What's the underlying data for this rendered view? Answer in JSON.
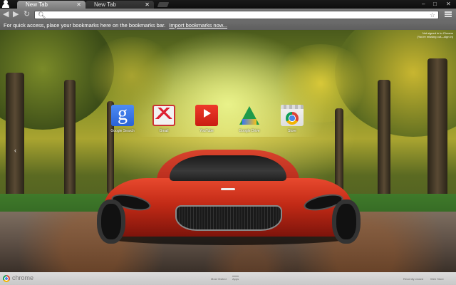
{
  "tabs": [
    {
      "label": "New Tab",
      "active": true
    },
    {
      "label": "New Tab",
      "active": false
    }
  ],
  "window_controls": {
    "minimize": "–",
    "maximize": "□",
    "close": "✕"
  },
  "toolbar": {
    "back_icon": "◀",
    "forward_icon": "▶",
    "reload_icon": "↻",
    "omnibox_value": "",
    "omnibox_placeholder": ""
  },
  "bookmarks_bar": {
    "message": "For quick access, place your bookmarks here on the bookmarks bar.",
    "import_link": "Import bookmarks now..."
  },
  "signin": {
    "line1": "Not signed in to Chrome",
    "line2": "(You're missing out—sign in)"
  },
  "apps": [
    {
      "label": "Google Search",
      "icon": "google-search-icon"
    },
    {
      "label": "Gmail",
      "icon": "gmail-icon"
    },
    {
      "label": "YouTube",
      "icon": "youtube-icon"
    },
    {
      "label": "Google Drive",
      "icon": "google-drive-icon"
    },
    {
      "label": "Store",
      "icon": "chrome-web-store-icon"
    }
  ],
  "footer": {
    "brand": "chrome",
    "panes": [
      "Most Visited",
      "Apps"
    ],
    "active_pane": "Apps",
    "recently_closed": "Recently closed",
    "web_store": "Web Store"
  },
  "colors": {
    "tab_active": "#8a8a8a",
    "toolbar": "#727272",
    "bookmarks_bar": "#656565",
    "footer": "#d0d0d0"
  }
}
